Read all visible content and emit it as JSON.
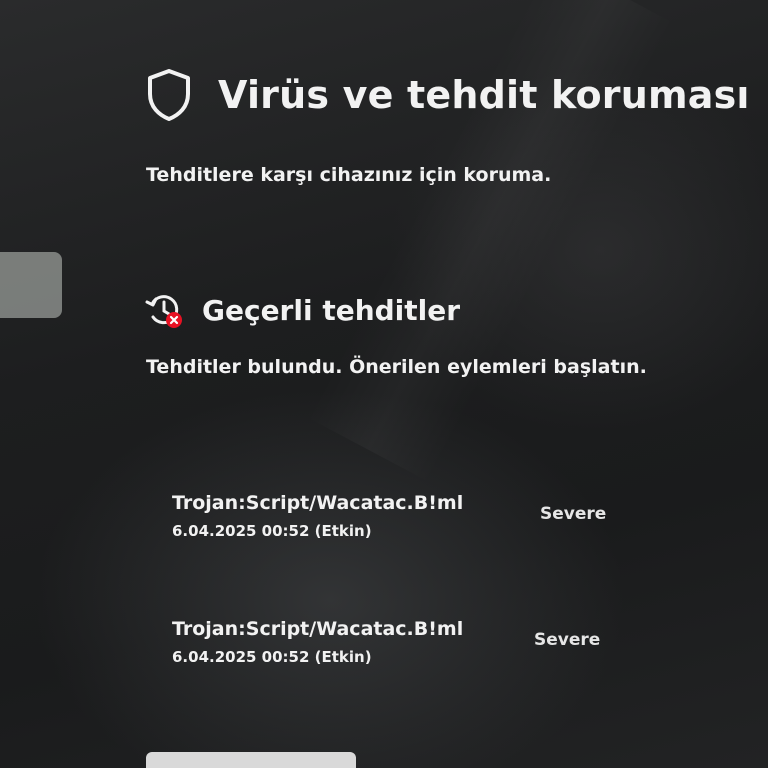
{
  "page": {
    "title": "Virüs ve tehdit koruması",
    "subtitle": "Tehditlere karşı cihazınız için koruma.",
    "header_icon": "shield-icon"
  },
  "current_threats": {
    "title": "Geçerli tehditler",
    "icon": "threat-history-warning-icon",
    "description": "Tehditler bulundu. Önerilen eylemleri başlatın.",
    "items": [
      {
        "name": "Trojan:Script/Wacatac.B!ml",
        "date": "6.04.2025 00:52 (Etkin)",
        "severity": "Severe"
      },
      {
        "name": "Trojan:Script/Wacatac.B!ml",
        "date": "6.04.2025 00:52 (Etkin)",
        "severity": "Severe"
      }
    ]
  },
  "colors": {
    "background": "#1c1d1e",
    "text": "#f2f2f2",
    "alert_red": "#e81123",
    "nav_selected": "#8a8d8a"
  }
}
